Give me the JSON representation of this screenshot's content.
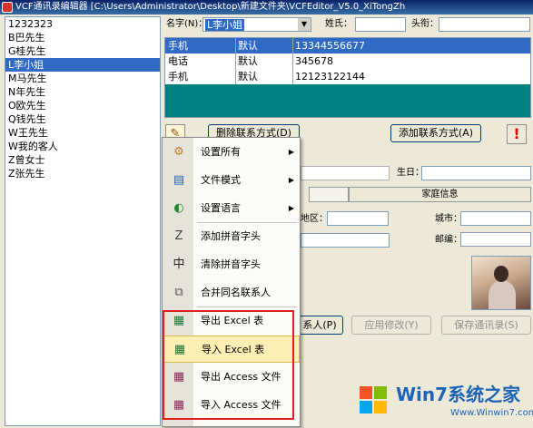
{
  "window": {
    "title": "VCF通讯录编辑器 [C:\\Users\\Administrator\\Desktop\\新建文件夹\\VCFEditor_V5.0_XiTongZh"
  },
  "contacts": [
    "1232323",
    "B巴先生",
    "G桂先生",
    "L李小姐",
    "M马先生",
    "N年先生",
    "O欧先生",
    "Q钱先生",
    "W王先生",
    "W我的客人",
    "Z曾女士",
    "Z张先生"
  ],
  "selected_contact_index": 3,
  "header": {
    "name_label": "名字(N)：",
    "name_value": "L李小姐",
    "surname_label": "姓氏：",
    "title_label": "头衔："
  },
  "phones": [
    {
      "type": "手机",
      "label": "默认",
      "number": "13344556677"
    },
    {
      "type": "电话",
      "label": "默认",
      "number": "345678"
    },
    {
      "type": "手机",
      "label": "默认",
      "number": "12123122144"
    }
  ],
  "buttons": {
    "delete_contact": "删除联系方式(D)",
    "add_contact": "添加联系方式(A)",
    "add_person": "系人(P)",
    "apply": "应用修改(Y)",
    "save": "保存通讯录(S)"
  },
  "form": {
    "birthday_label": "生日：",
    "district_label": "地区：",
    "city_label": "城市：",
    "postcode_label": "邮编："
  },
  "tabs": [
    {
      "label": ""
    },
    {
      "label": "家庭信息"
    }
  ],
  "menu": {
    "items": [
      {
        "label": "设置所有",
        "icon": "settings-icon",
        "submenu": true
      },
      {
        "label": "文件模式",
        "icon": "file-mode-icon",
        "submenu": true
      },
      {
        "label": "设置语言",
        "icon": "language-icon",
        "submenu": true
      },
      {
        "label": "添加拼音字头",
        "icon": "pinyin-add-icon",
        "submenu": false
      },
      {
        "label": "清除拼音字头",
        "icon": "pinyin-clear-icon",
        "submenu": false
      },
      {
        "label": "合并同名联系人",
        "icon": "merge-icon",
        "submenu": false
      },
      {
        "label": "导出 Excel 表",
        "icon": "export-excel-icon",
        "submenu": false
      },
      {
        "label": "导入 Excel 表",
        "icon": "import-excel-icon",
        "submenu": false
      },
      {
        "label": "导出 Access 文件",
        "icon": "export-access-icon",
        "submenu": false
      },
      {
        "label": "导入 Access 文件",
        "icon": "import-access-icon",
        "submenu": false
      }
    ],
    "highlighted_index": 7
  },
  "watermark": {
    "brand": "Win7系统之家",
    "url": "Www.Winwin7.com"
  }
}
